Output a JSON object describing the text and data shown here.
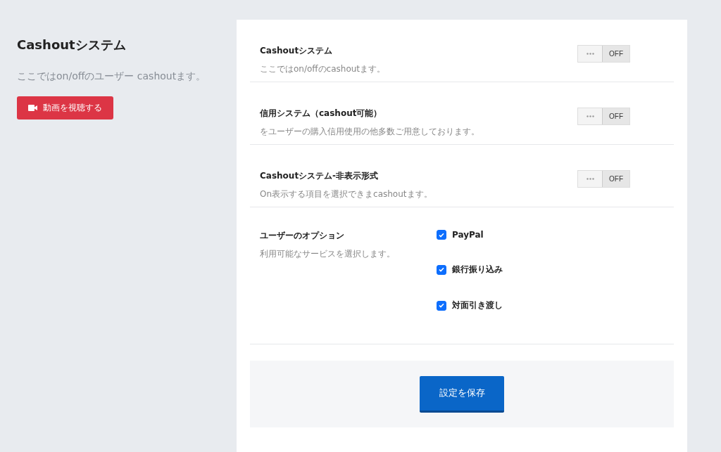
{
  "intro": {
    "title": "Cashoutシステム",
    "description": "ここではon/offのユーザー cashoutます。",
    "video_button": "動画を視聴する"
  },
  "settings": [
    {
      "title": "Cashoutシステム",
      "description": "ここではon/offのcashoutます。",
      "toggle_label": "OFF",
      "on": false
    },
    {
      "title": "信用システム（cashout可能）",
      "description": "をユーザーの購入信用使用の他多数ご用意しております。",
      "toggle_label": "OFF",
      "on": false
    },
    {
      "title": "Cashoutシステム-非表示形式",
      "description": "On表示する項目を選択できまcashoutます。",
      "toggle_label": "OFF",
      "on": false
    }
  ],
  "options": {
    "title": "ユーザーのオプション",
    "description": "利用可能なサービスを選択します。",
    "items": [
      {
        "label": "PayPal",
        "checked": true
      },
      {
        "label": "銀行振り込み",
        "checked": true
      },
      {
        "label": "対面引き渡し",
        "checked": true
      }
    ]
  },
  "save_button": "設定を保存"
}
